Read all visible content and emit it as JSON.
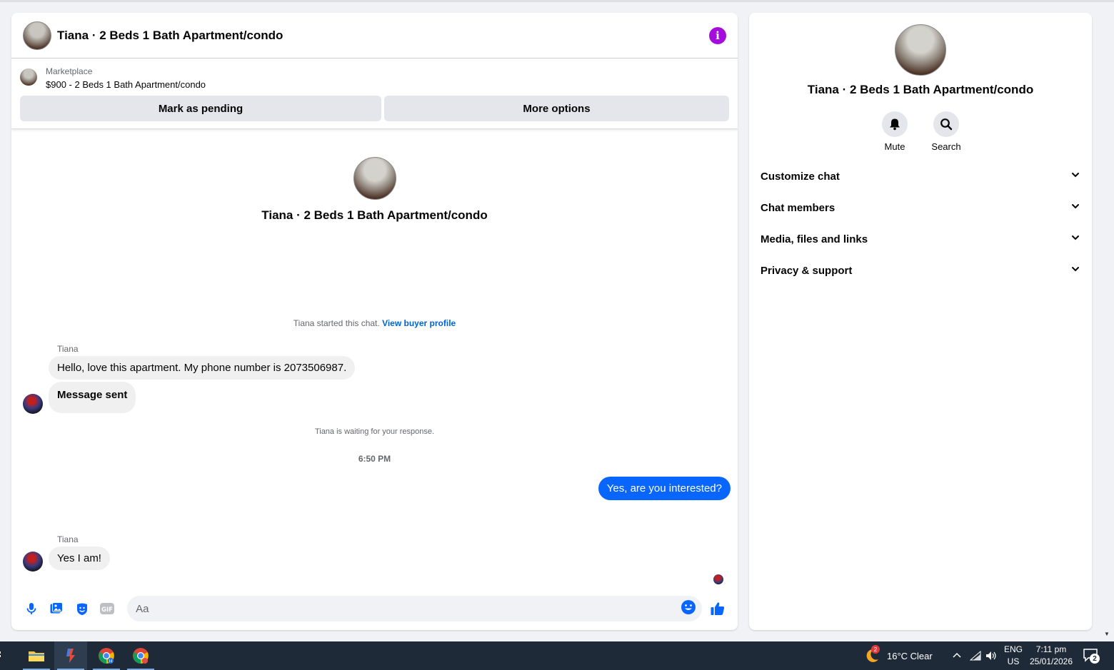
{
  "conversation": {
    "title": "Tiana · 2 Beds 1 Bath Apartment/condo",
    "marketplace_label": "Marketplace",
    "listing": "$900 - 2 Beds 1 Bath Apartment/condo",
    "mark_pending": "Mark as pending",
    "more_options": "More options"
  },
  "intro": {
    "title": "Tiana · 2 Beds 1 Bath Apartment/condo"
  },
  "thread": {
    "started_text": "Tiana started this chat.",
    "view_profile": "View buyer profile",
    "sender1": "Tiana",
    "msg1": "Hello, love this apartment. My phone number is 2073506987.",
    "msg2": "Message sent",
    "waiting": "Tiana is waiting for your response.",
    "timestamp": "6:50 PM",
    "reply": "Yes, are you interested?",
    "sender2": "Tiana",
    "msg3": "Yes I am!"
  },
  "composer": {
    "placeholder": "Aa",
    "gif_label": "GIF"
  },
  "sidebar": {
    "title": "Tiana · 2 Beds 1 Bath Apartment/condo",
    "mute": "Mute",
    "search": "Search",
    "sections": [
      {
        "label": "Customize chat"
      },
      {
        "label": "Chat members"
      },
      {
        "label": "Media, files and links"
      },
      {
        "label": "Privacy & support"
      }
    ]
  },
  "taskbar": {
    "weather_badge": "2",
    "weather": "16°C  Clear",
    "lang_top": "ENG",
    "lang_bottom": "US",
    "time": "7:11 pm",
    "date": "25/01/2026",
    "notification_count": "2"
  },
  "colors": {
    "accent": "#0866ff",
    "info": "#a40ddb",
    "taskbar": "#1f2a38"
  }
}
